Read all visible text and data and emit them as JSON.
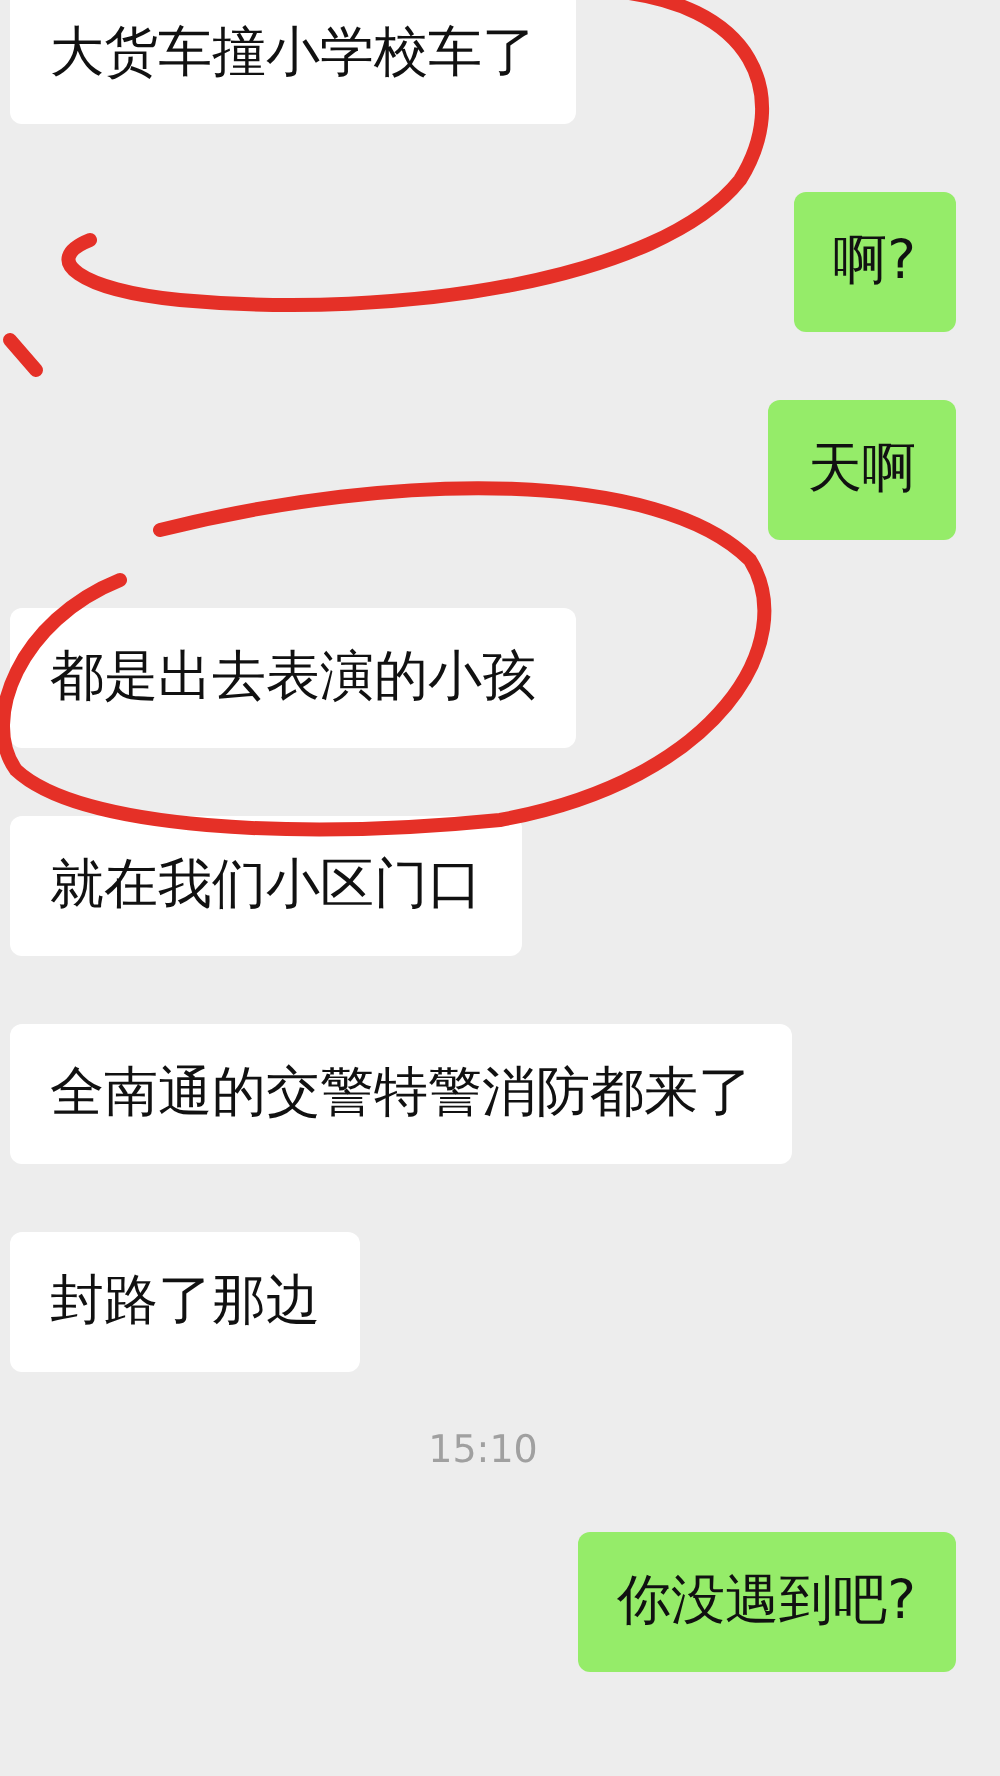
{
  "messages": [
    {
      "kind": "incoming",
      "text": "大货车撞小学校车了"
    },
    {
      "kind": "outgoing",
      "text": "啊?"
    },
    {
      "kind": "outgoing",
      "text": "天啊"
    },
    {
      "kind": "incoming",
      "text": "都是出去表演的小孩"
    },
    {
      "kind": "incoming",
      "text": "就在我们小区门口"
    },
    {
      "kind": "incoming",
      "text": "全南通的交警特警消防都来了"
    },
    {
      "kind": "incoming",
      "text": "封路了那边"
    },
    {
      "kind": "time",
      "text": "15:10"
    },
    {
      "kind": "outgoing",
      "text": "你没遇到吧?"
    }
  ]
}
